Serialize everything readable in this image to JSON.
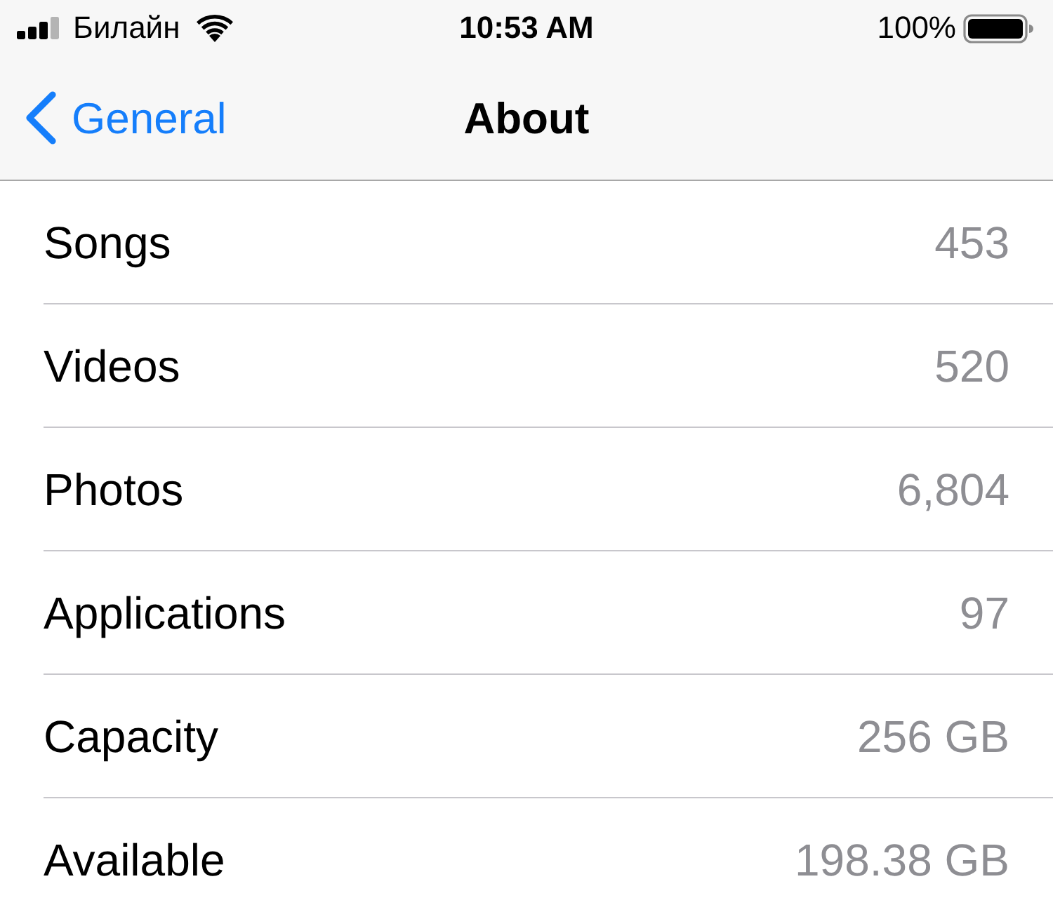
{
  "status_bar": {
    "carrier": "Билайн",
    "time": "10:53 AM",
    "battery": "100%"
  },
  "nav_bar": {
    "back_label": "General",
    "title": "About"
  },
  "rows": [
    {
      "label": "Songs",
      "value": "453"
    },
    {
      "label": "Videos",
      "value": "520"
    },
    {
      "label": "Photos",
      "value": "6,804"
    },
    {
      "label": "Applications",
      "value": "97"
    },
    {
      "label": "Capacity",
      "value": "256 GB"
    },
    {
      "label": "Available",
      "value": "198.38 GB"
    }
  ]
}
